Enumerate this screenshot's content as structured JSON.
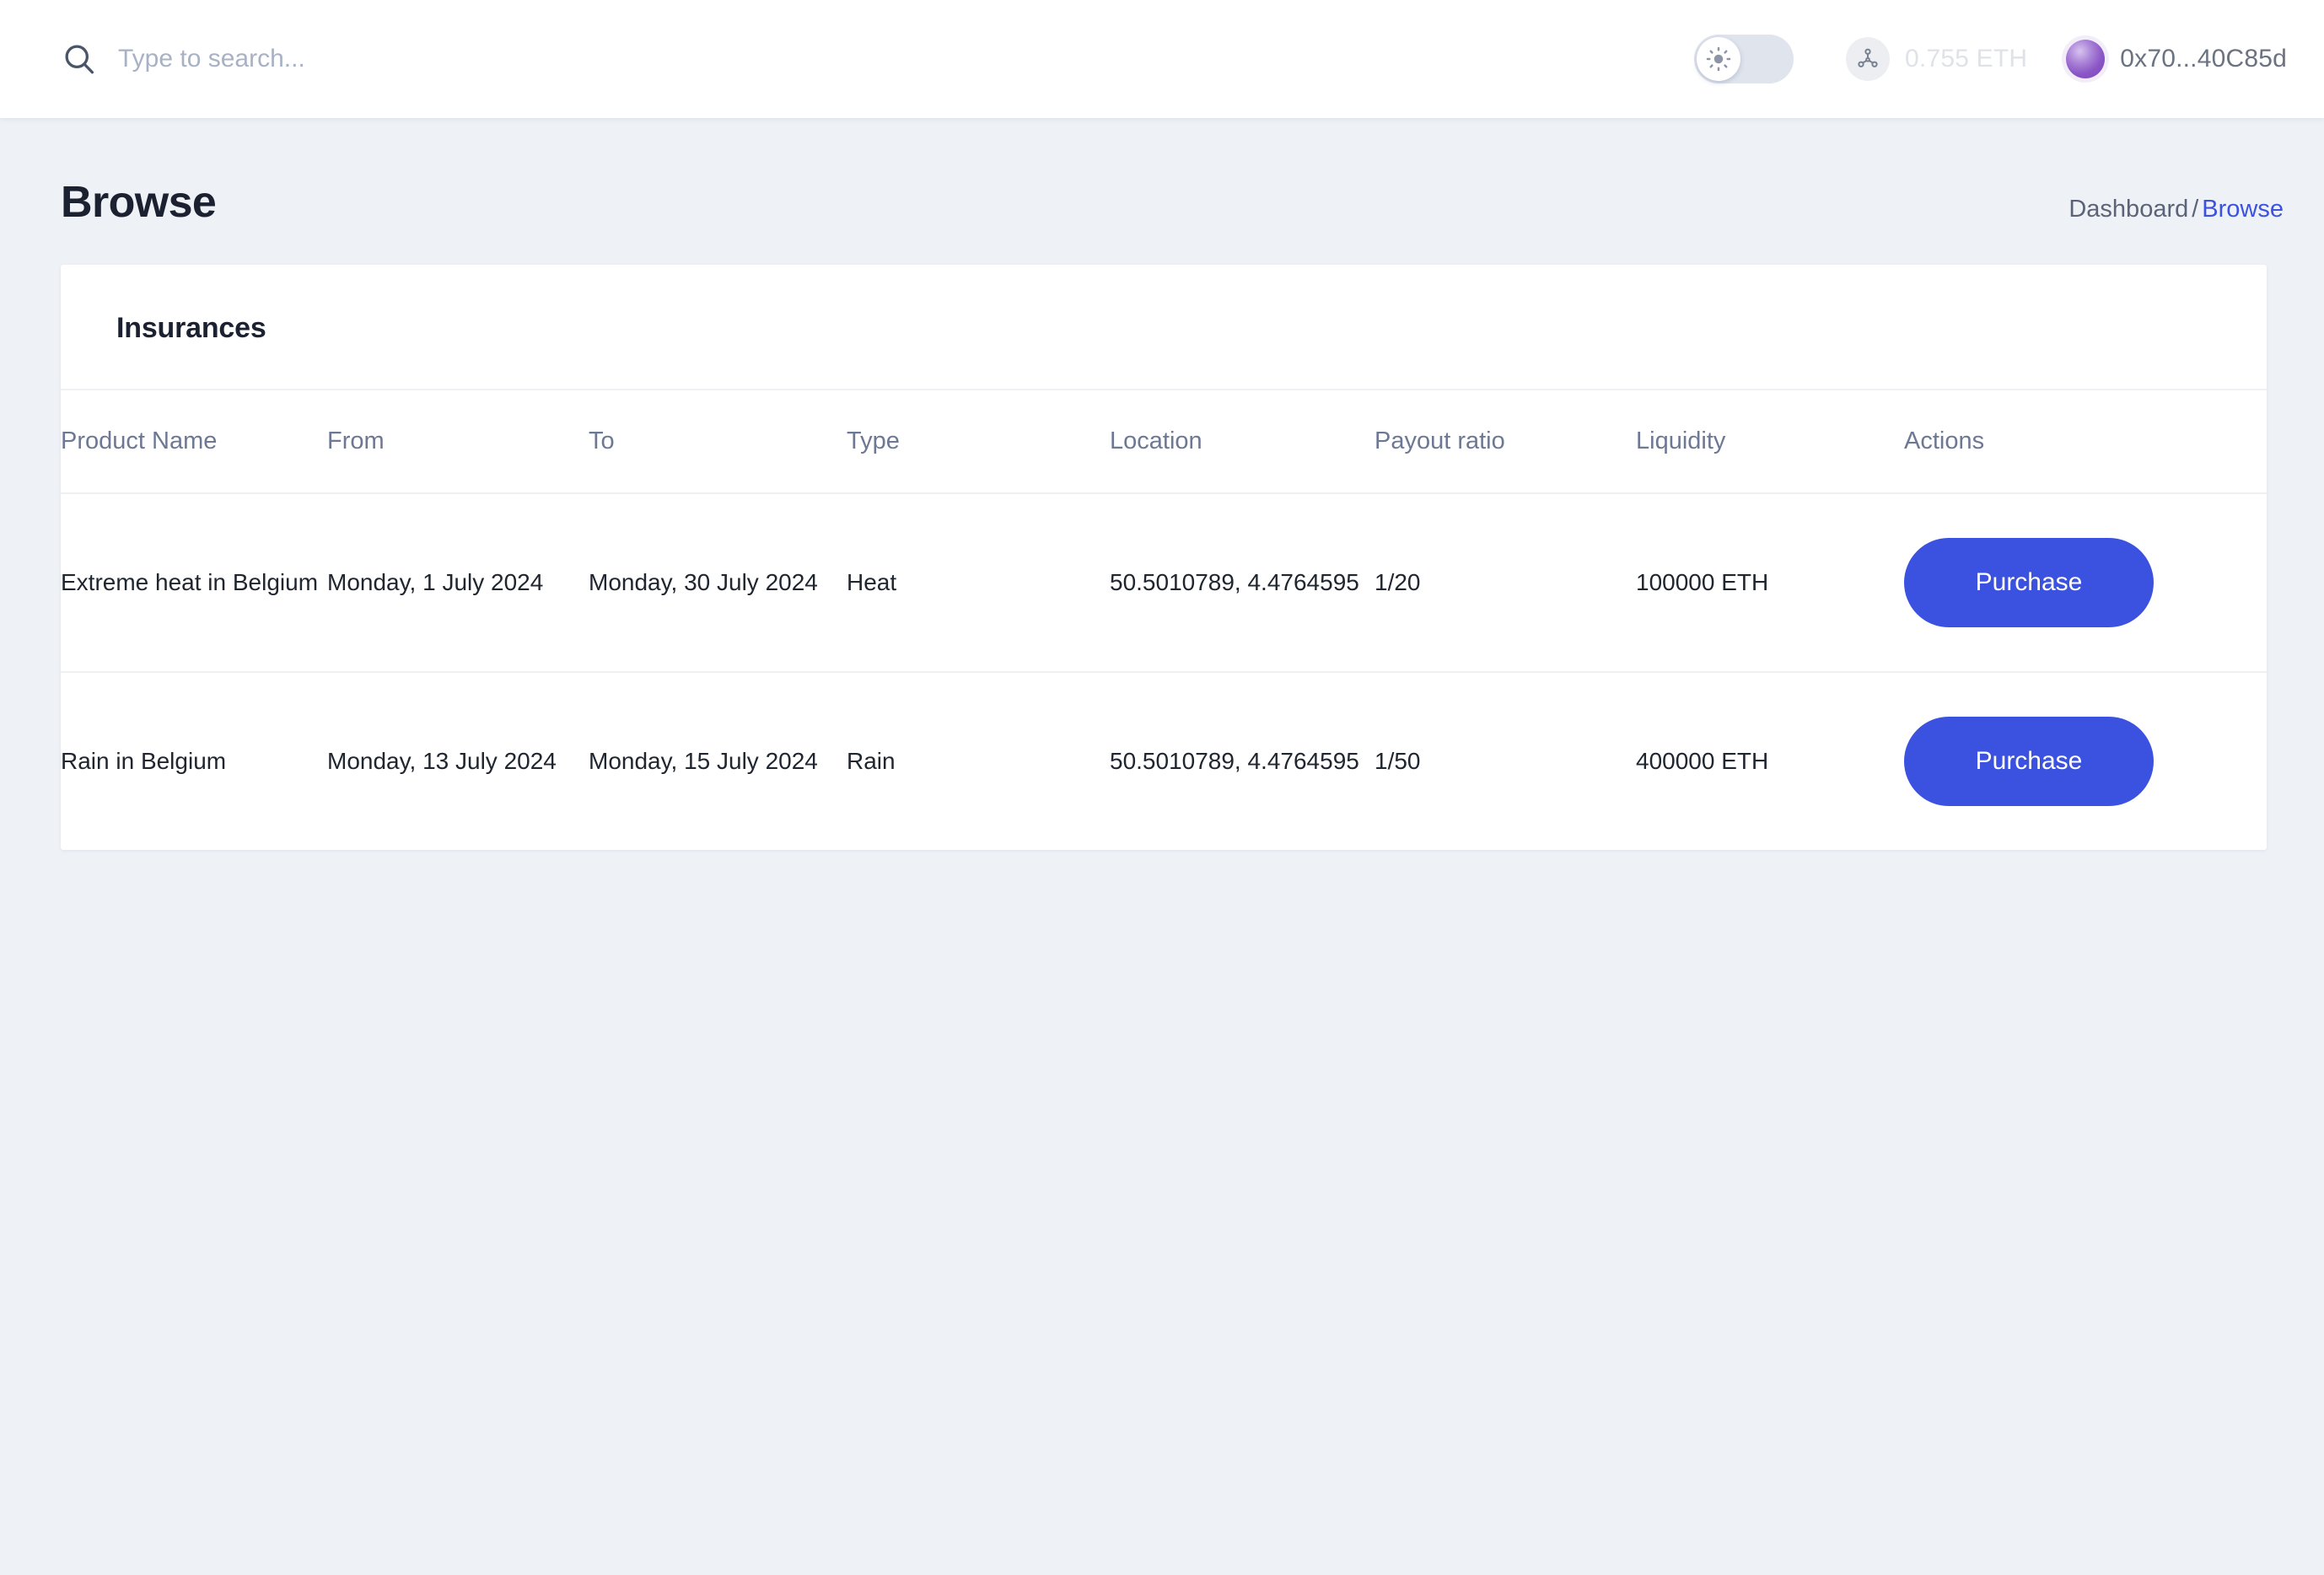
{
  "topbar": {
    "search": {
      "icon": "search-icon",
      "placeholder": "Type to search...",
      "value": ""
    },
    "theme_toggle": {
      "icon": "sun-icon",
      "state": "light",
      "checked": false
    },
    "balance": {
      "icon": "network-icon",
      "text": "0.755 ETH"
    },
    "wallet": {
      "avatar": "wallet-avatar",
      "address": "0x70...40C85d"
    }
  },
  "page": {
    "title": "Browse",
    "breadcrumb": {
      "parent": "Dashboard",
      "separator": "/",
      "current": "Browse"
    }
  },
  "card": {
    "title": "Insurances",
    "table": {
      "columns": [
        "Product Name",
        "From",
        "To",
        "Type",
        "Location",
        "Payout ratio",
        "Liquidity",
        "Actions"
      ],
      "rows": [
        {
          "product_name": "Extreme heat in Belgium",
          "from": "Monday, 1 July 2024",
          "to": "Monday, 30 July 2024",
          "type": "Heat",
          "location": "50.5010789, 4.4764595",
          "payout_ratio": "1/20",
          "liquidity": "100000 ETH",
          "action_label": "Purchase"
        },
        {
          "product_name": "Rain in Belgium",
          "from": "Monday, 13 July 2024",
          "to": "Monday, 15 July 2024",
          "type": "Rain",
          "location": "50.5010789, 4.4764595",
          "payout_ratio": "1/50",
          "liquidity": "400000 ETH",
          "action_label": "Purchase"
        }
      ]
    }
  },
  "colors": {
    "accent": "#3b52e0",
    "page_background": "#eef1f6",
    "surface": "#ffffff",
    "text_primary": "#1b2130",
    "text_muted": "#6d7894",
    "avatar_purple": "#8a55c6"
  }
}
